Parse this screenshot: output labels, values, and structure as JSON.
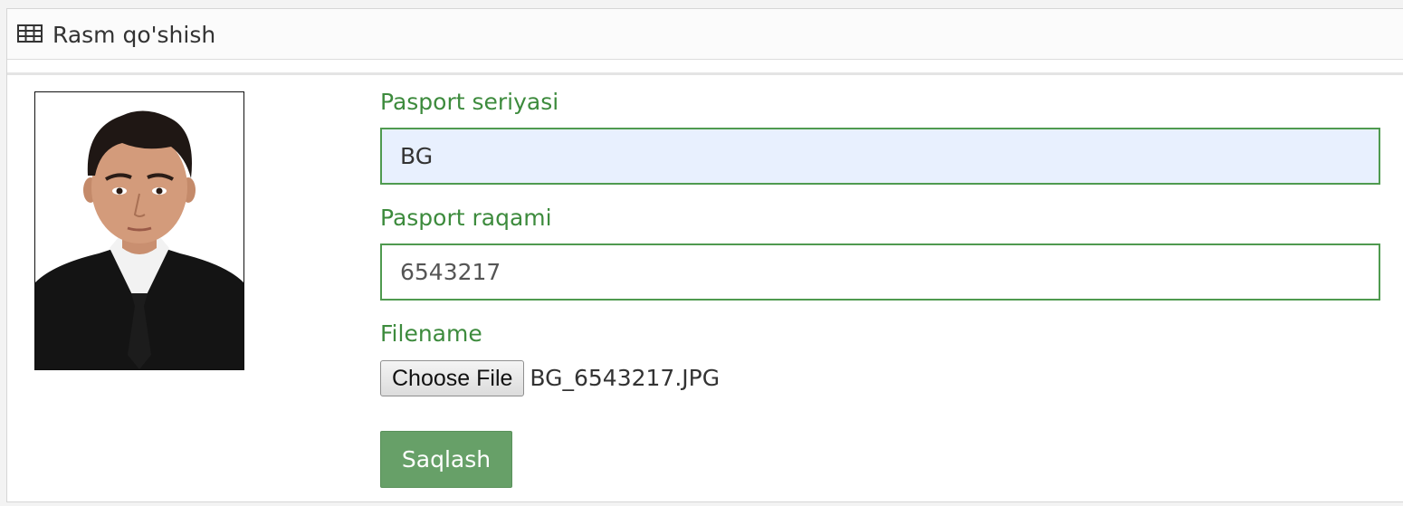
{
  "panel": {
    "title": "Rasm qo'shish",
    "title_icon": "table-icon"
  },
  "photo": {
    "icon": "passport-photo"
  },
  "form": {
    "series": {
      "label": "Pasport seriyasi",
      "value": "BG"
    },
    "number": {
      "label": "Pasport raqami",
      "value": "6543217"
    },
    "file": {
      "label": "Filename",
      "button_label": "Choose File",
      "selected_file": "BG_6543217.JPG"
    },
    "submit_label": "Saqlash"
  },
  "colors": {
    "label_green": "#3d8b3d",
    "field_border": "#4f9a4f",
    "autofill_bg": "#e8f0fe",
    "save_button_bg": "#67a068"
  }
}
